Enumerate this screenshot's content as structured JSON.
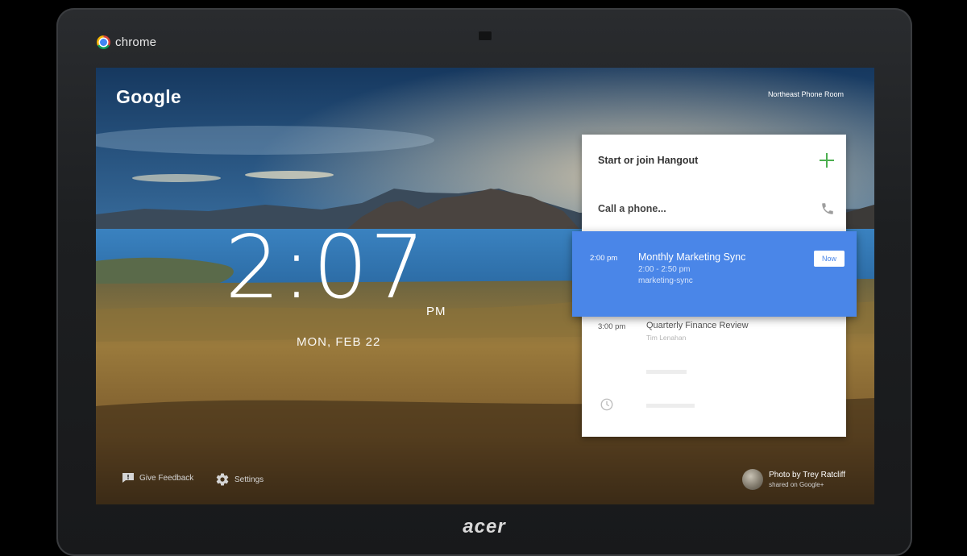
{
  "device": {
    "browser_label": "chrome",
    "brand": "acer"
  },
  "screen": {
    "logo": "Google",
    "room_name": "Northeast Phone Room",
    "clock": {
      "time": "2:07",
      "ampm": "PM",
      "date": "MON, FEB 22"
    },
    "actions": {
      "start_hangout": "Start or join Hangout",
      "call_phone": "Call a phone..."
    },
    "events": [
      {
        "time": "2:00 pm",
        "title": "Monthly Marketing Sync",
        "range": "2:00 - 2:50 pm",
        "room": "marketing-sync",
        "action": "Now"
      },
      {
        "time": "3:00 pm",
        "title": "Quarterly Finance Review",
        "subtitle": "Tim Lenahan"
      }
    ],
    "footer": {
      "feedback": "Give Feedback",
      "settings": "Settings",
      "photo_credit": "Photo by Trey Ratcliff",
      "photo_source": "shared on Google+"
    }
  },
  "icons": [
    "chrome-logo",
    "plus-icon",
    "phone-icon",
    "clock-icon",
    "feedback-icon",
    "gear-icon",
    "avatar"
  ],
  "colors": {
    "accent_blue": "#4a86e8",
    "plus_green": "#4caf50",
    "card_bg": "#ffffff"
  }
}
